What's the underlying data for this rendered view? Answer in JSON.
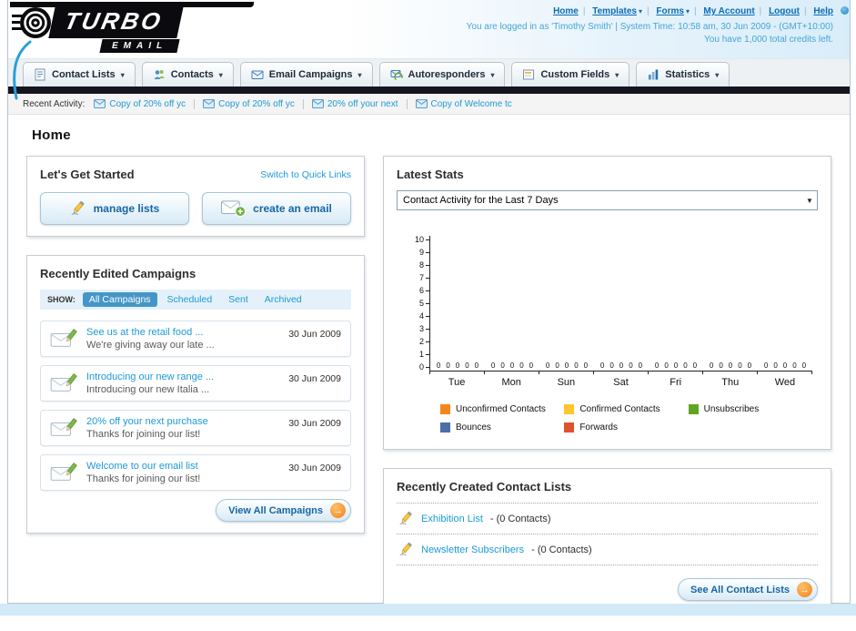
{
  "colors": {
    "accent_blue": "#1d9ad6",
    "dark_bar": "#15151f",
    "button_text_blue": "#1766a5",
    "action_orange": "#f6851f"
  },
  "header": {
    "logo_line1": "TURBO",
    "logo_line2": "EMAIL",
    "nav_links": [
      {
        "label": "Home",
        "dropdown": false
      },
      {
        "label": "Templates",
        "dropdown": true
      },
      {
        "label": "Forms",
        "dropdown": true
      },
      {
        "label": "My Account",
        "dropdown": false
      },
      {
        "label": "Logout",
        "dropdown": false
      },
      {
        "label": "Help",
        "dropdown": false
      }
    ],
    "login_info": "You are logged in as 'Timothy Smith' | System Time: 10:58 am, 30 Jun 2009 - (GMT+10:00)",
    "credits_info": "You have 1,000 total credits left."
  },
  "nav_tabs": [
    {
      "label": "Contact Lists"
    },
    {
      "label": "Contacts"
    },
    {
      "label": "Email Campaigns"
    },
    {
      "label": "Autoresponders"
    },
    {
      "label": "Custom Fields"
    },
    {
      "label": "Statistics"
    }
  ],
  "recent_activity": {
    "label": "Recent Activity:",
    "items": [
      {
        "title": "Copy of 20% off yc"
      },
      {
        "title": "Copy of 20% off yc"
      },
      {
        "title": "20% off your next"
      },
      {
        "title": "Copy of Welcome tc"
      }
    ]
  },
  "page_title": "Home",
  "get_started": {
    "title": "Let's Get Started",
    "switch_link": "Switch to Quick Links",
    "manage_lists_label": "manage lists",
    "create_email_label": "create an email"
  },
  "campaigns": {
    "title": "Recently Edited Campaigns",
    "show_label": "SHOW:",
    "filters": [
      {
        "label": "All Campaigns",
        "active": true
      },
      {
        "label": "Scheduled",
        "active": false
      },
      {
        "label": "Sent",
        "active": false
      },
      {
        "label": "Archived",
        "active": false
      }
    ],
    "items": [
      {
        "title": "See us at the retail food ...",
        "subtitle": "We're giving away our late ...",
        "date": "30 Jun 2009"
      },
      {
        "title": "Introducing our new range ...",
        "subtitle": "Introducing our new Italia ...",
        "date": "30 Jun 2009"
      },
      {
        "title": "20% off your next purchase",
        "subtitle": "Thanks for joining our list!",
        "date": "30 Jun 2009"
      },
      {
        "title": "Welcome to our email list",
        "subtitle": "Thanks for joining our list!",
        "date": "30 Jun 2009"
      }
    ],
    "view_all_label": "View All Campaigns"
  },
  "latest_stats": {
    "title": "Latest Stats",
    "period_selector": "Contact Activity for the Last 7 Days",
    "chart_data": {
      "type": "bar",
      "title": "Contact Activity for the Last 7 Days",
      "categories": [
        "Tue",
        "Mon",
        "Sun",
        "Sat",
        "Fri",
        "Thu",
        "Wed"
      ],
      "series": [
        {
          "name": "Unconfirmed Contacts",
          "color": "#f6851f",
          "values": [
            0,
            0,
            0,
            0,
            0,
            0,
            0
          ]
        },
        {
          "name": "Confirmed Contacts",
          "color": "#fdc62c",
          "values": [
            0,
            0,
            0,
            0,
            0,
            0,
            0
          ]
        },
        {
          "name": "Unsubscribes",
          "color": "#61a522",
          "values": [
            0,
            0,
            0,
            0,
            0,
            0,
            0
          ]
        },
        {
          "name": "Bounces",
          "color": "#4d6fa9",
          "values": [
            0,
            0,
            0,
            0,
            0,
            0,
            0
          ]
        },
        {
          "name": "Forwards",
          "color": "#e2512d",
          "values": [
            0,
            0,
            0,
            0,
            0,
            0,
            0
          ]
        }
      ],
      "ylim": [
        0,
        10
      ],
      "y_tick_step": 1,
      "grid": false,
      "legend_position": "bottom"
    }
  },
  "contact_lists": {
    "title": "Recently Created Contact Lists",
    "items": [
      {
        "name": "Exhibition List",
        "detail": "- (0 Contacts)"
      },
      {
        "name": "Newsletter Subscribers",
        "detail": "- (0 Contacts)"
      }
    ],
    "see_all_label": "See All Contact Lists"
  }
}
